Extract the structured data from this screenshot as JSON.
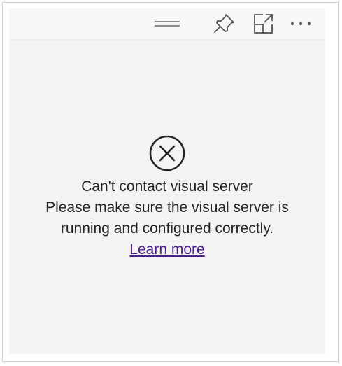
{
  "header": {
    "drag_icon": "drag-handle-icon",
    "pin_icon": "pin-icon",
    "focus_icon": "focus-mode-icon",
    "more_icon": "more-options-icon"
  },
  "error": {
    "icon": "error-circle-x-icon",
    "title": "Can't contact visual server",
    "line1": "Please make sure the visual server is",
    "line2": "running and configured correctly.",
    "link_label": "Learn more"
  },
  "colors": {
    "tile_background": "#f3f3f3",
    "text": "#252423",
    "link": "#4b1d8e",
    "icon": "#555555"
  }
}
